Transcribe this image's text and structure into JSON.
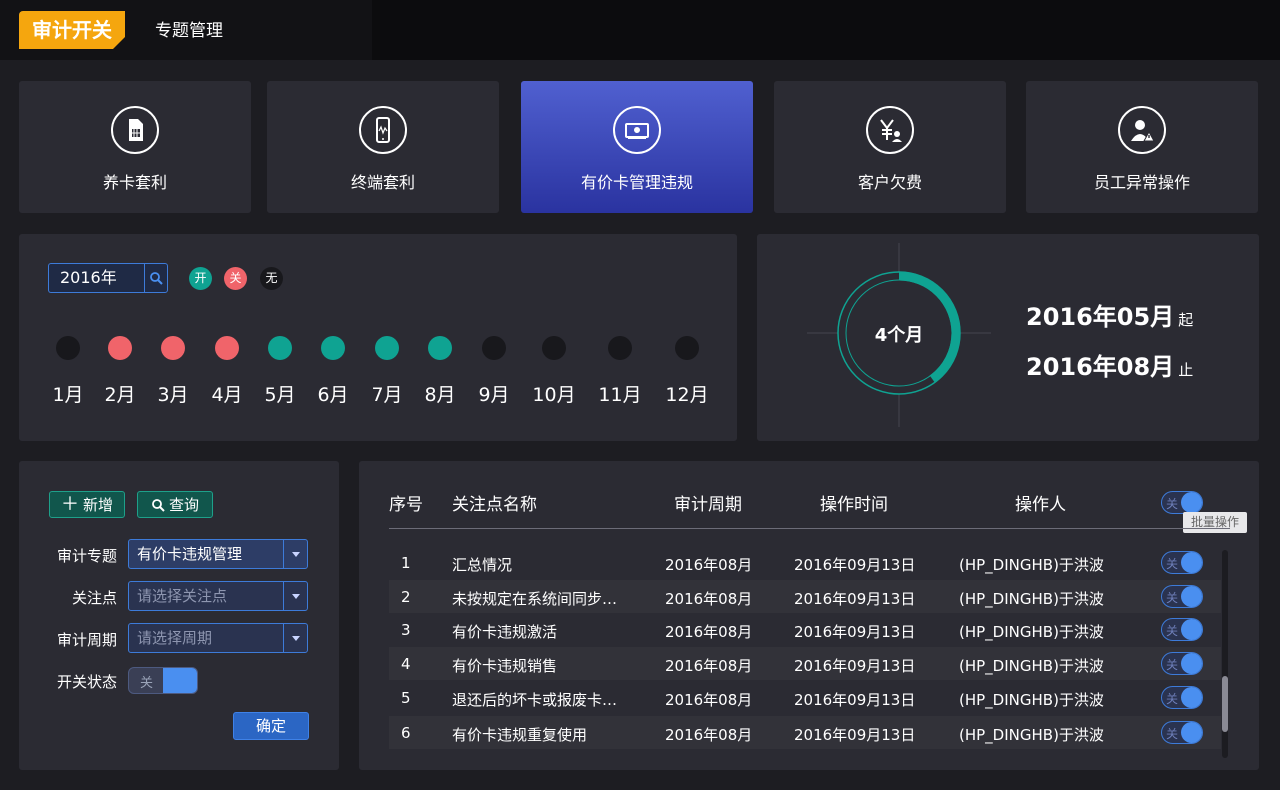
{
  "header": {
    "brand": "审计开关",
    "title": "专题管理"
  },
  "categories": [
    {
      "label": "养卡套利",
      "icon": "sim-card-icon",
      "active": false
    },
    {
      "label": "终端套利",
      "icon": "phone-icon",
      "active": false
    },
    {
      "label": "有价卡管理违规",
      "icon": "card-reader-icon",
      "active": true
    },
    {
      "label": "客户欠费",
      "icon": "yen-user-icon",
      "active": false
    },
    {
      "label": "员工异常操作",
      "icon": "user-warning-icon",
      "active": false
    }
  ],
  "calendar": {
    "year_value": "2016年",
    "legend": {
      "on": "开",
      "off": "关",
      "none": "无"
    },
    "colors": {
      "on": "#0fa392",
      "off": "#f0646a",
      "none": "#18181c"
    },
    "months": [
      {
        "label": "1月",
        "state": "none"
      },
      {
        "label": "2月",
        "state": "off"
      },
      {
        "label": "3月",
        "state": "off"
      },
      {
        "label": "4月",
        "state": "off"
      },
      {
        "label": "5月",
        "state": "on"
      },
      {
        "label": "6月",
        "state": "on"
      },
      {
        "label": "7月",
        "state": "on"
      },
      {
        "label": "8月",
        "state": "on"
      },
      {
        "label": "9月",
        "state": "none"
      },
      {
        "label": "10月",
        "state": "none"
      },
      {
        "label": "11月",
        "state": "none"
      },
      {
        "label": "12月",
        "state": "none"
      }
    ]
  },
  "period": {
    "duration": "4个月",
    "start": "2016年05月",
    "start_suffix": "起",
    "end": "2016年08月",
    "end_suffix": "止",
    "progress_fraction": 0.4
  },
  "form": {
    "add_label": "新增",
    "query_label": "查询",
    "topic_label": "审计专题",
    "topic_value": "有价卡违规管理",
    "focus_label": "关注点",
    "focus_placeholder": "请选择关注点",
    "cycle_label": "审计周期",
    "cycle_placeholder": "请选择周期",
    "status_label": "开关状态",
    "status_off": "关",
    "confirm_label": "确定"
  },
  "table": {
    "headers": {
      "index": "序号",
      "name": "关注点名称",
      "cycle": "审计周期",
      "time": "操作时间",
      "operator": "操作人"
    },
    "batch_tooltip": "批量操作",
    "toggle_off": "关",
    "rows": [
      {
        "index": "1",
        "name": "汇总情况",
        "cycle": "2016年08月",
        "time": "2016年09月13日",
        "operator": "(HP_DINGHB)于洪波"
      },
      {
        "index": "2",
        "name": "未按规定在系统间同步…",
        "cycle": "2016年08月",
        "time": "2016年09月13日",
        "operator": "(HP_DINGHB)于洪波"
      },
      {
        "index": "3",
        "name": "有价卡违规激活",
        "cycle": "2016年08月",
        "time": "2016年09月13日",
        "operator": "(HP_DINGHB)于洪波"
      },
      {
        "index": "4",
        "name": "有价卡违规销售",
        "cycle": "2016年08月",
        "time": "2016年09月13日",
        "operator": "(HP_DINGHB)于洪波"
      },
      {
        "index": "5",
        "name": "退还后的坏卡或报废卡…",
        "cycle": "2016年08月",
        "time": "2016年09月13日",
        "operator": "(HP_DINGHB)于洪波"
      },
      {
        "index": "6",
        "name": "有价卡违规重复使用",
        "cycle": "2016年08月",
        "time": "2016年09月13日",
        "operator": "(HP_DINGHB)于洪波"
      }
    ]
  }
}
